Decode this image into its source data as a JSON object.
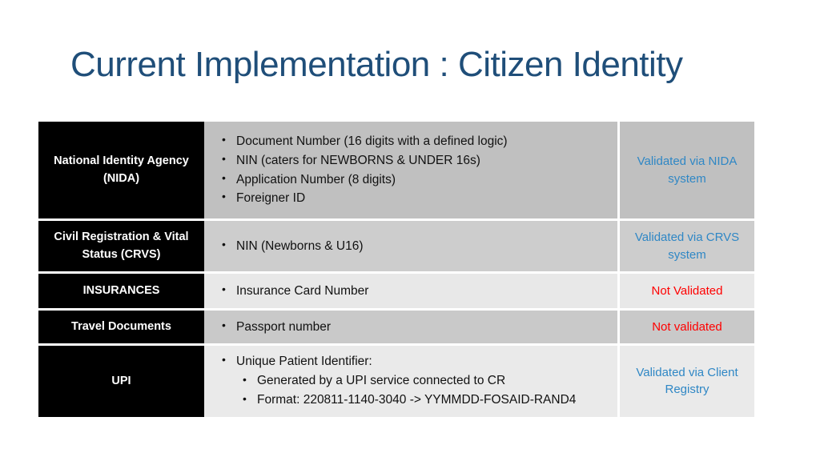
{
  "slide": {
    "title": "Current Implementation : Citizen Identity",
    "title_color": "#1f4e79",
    "background": "#ffffff"
  },
  "colors": {
    "agency_bg": "#000000",
    "agency_text": "#ffffff",
    "validated_text": "#2f87c5",
    "not_validated_text": "#ff0000"
  },
  "table": {
    "rows": [
      {
        "agency": "National Identity Agency (NIDA)",
        "identifiers": [
          {
            "text": "Document Number (16 digits with a defined logic)",
            "sub": []
          },
          {
            "text": "NIN (caters for NEWBORNS & UNDER 16s)",
            "sub": []
          },
          {
            "text": "Application Number (8 digits)",
            "sub": []
          },
          {
            "text": "Foreigner ID",
            "sub": []
          }
        ],
        "status": "Validated via NIDA system",
        "status_kind": "validated"
      },
      {
        "agency": "Civil Registration & Vital Status (CRVS)",
        "identifiers": [
          {
            "text": "NIN (Newborns & U16)",
            "sub": []
          }
        ],
        "status": "Validated via CRVS system",
        "status_kind": "validated"
      },
      {
        "agency": "INSURANCES",
        "identifiers": [
          {
            "text": "Insurance Card Number",
            "sub": []
          }
        ],
        "status": "Not Validated",
        "status_kind": "not_validated"
      },
      {
        "agency": "Travel Documents",
        "identifiers": [
          {
            "text": "Passport number",
            "sub": []
          }
        ],
        "status": "Not validated",
        "status_kind": "not_validated"
      },
      {
        "agency": "UPI",
        "identifiers": [
          {
            "text": "Unique Patient Identifier:",
            "sub": [
              "Generated by a UPI service connected to CR",
              "Format: 220811-1140-3040 -> YYMMDD-FOSAID-RAND4"
            ]
          }
        ],
        "status": "Validated via Client Registry",
        "status_kind": "validated"
      }
    ]
  }
}
